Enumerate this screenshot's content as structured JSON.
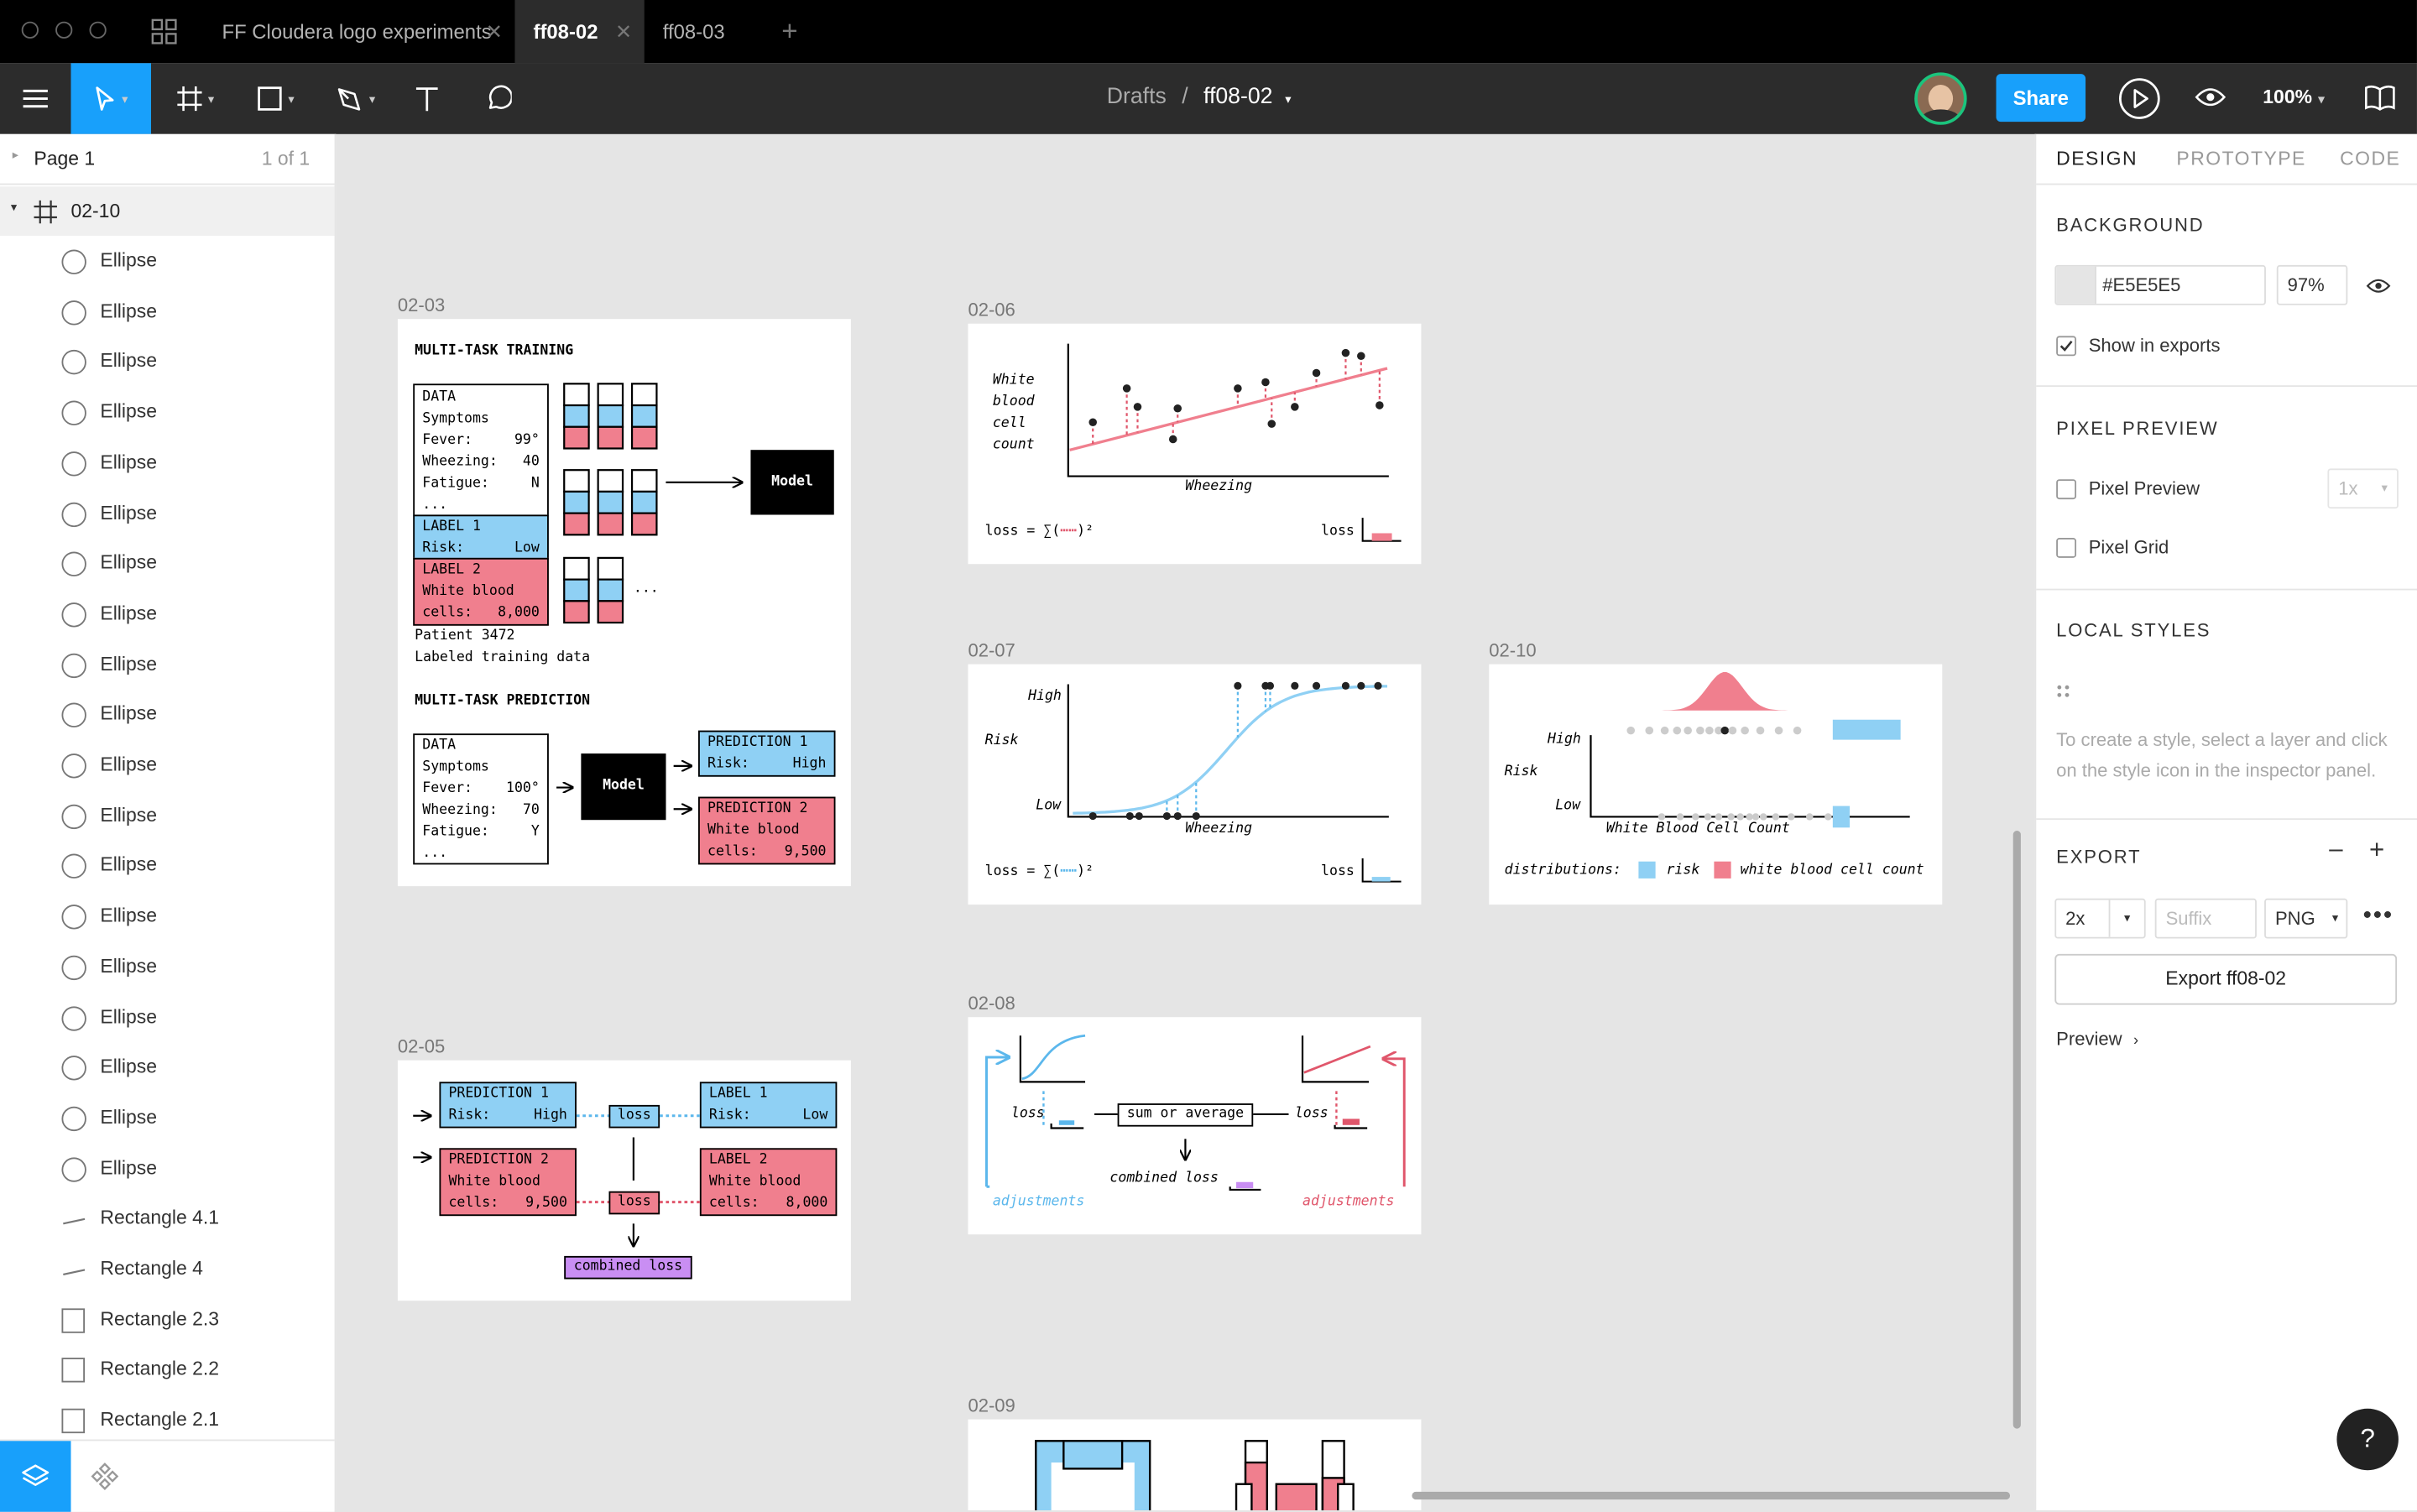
{
  "window": {
    "tabs": [
      {
        "label": "FF Cloudera logo experiments",
        "active": false
      },
      {
        "label": "ff08-02",
        "active": true
      },
      {
        "label": "ff08-03",
        "active": false
      }
    ]
  },
  "toolbar": {
    "breadcrumb_root": "Drafts",
    "breadcrumb_sep": "/",
    "file_name": "ff08-02",
    "share_label": "Share",
    "zoom": "100%"
  },
  "layers": {
    "page_name": "Page 1",
    "page_count": "1 of 1",
    "frame_name": "02-10",
    "items": [
      {
        "name": "Ellipse",
        "kind": "ellipse"
      },
      {
        "name": "Ellipse",
        "kind": "ellipse"
      },
      {
        "name": "Ellipse",
        "kind": "ellipse"
      },
      {
        "name": "Ellipse",
        "kind": "ellipse"
      },
      {
        "name": "Ellipse",
        "kind": "ellipse"
      },
      {
        "name": "Ellipse",
        "kind": "ellipse"
      },
      {
        "name": "Ellipse",
        "kind": "ellipse"
      },
      {
        "name": "Ellipse",
        "kind": "ellipse"
      },
      {
        "name": "Ellipse",
        "kind": "ellipse"
      },
      {
        "name": "Ellipse",
        "kind": "ellipse"
      },
      {
        "name": "Ellipse",
        "kind": "ellipse"
      },
      {
        "name": "Ellipse",
        "kind": "ellipse"
      },
      {
        "name": "Ellipse",
        "kind": "ellipse"
      },
      {
        "name": "Ellipse",
        "kind": "ellipse"
      },
      {
        "name": "Ellipse",
        "kind": "ellipse"
      },
      {
        "name": "Ellipse",
        "kind": "ellipse"
      },
      {
        "name": "Ellipse",
        "kind": "ellipse"
      },
      {
        "name": "Ellipse",
        "kind": "ellipse"
      },
      {
        "name": "Ellipse",
        "kind": "ellipse"
      },
      {
        "name": "Rectangle 4.1",
        "kind": "vector"
      },
      {
        "name": "Rectangle 4",
        "kind": "vector"
      },
      {
        "name": "Rectangle 2.3",
        "kind": "rect"
      },
      {
        "name": "Rectangle 2.2",
        "kind": "rect"
      },
      {
        "name": "Rectangle 2.1",
        "kind": "rect"
      }
    ]
  },
  "inspector": {
    "tabs": [
      "DESIGN",
      "PROTOTYPE",
      "CODE"
    ],
    "background_title": "BACKGROUND",
    "bg_color": "#E5E5E5",
    "bg_opacity": "97%",
    "show_in_exports": "Show in exports",
    "pixel_preview_title": "PIXEL PREVIEW",
    "pixel_preview": "Pixel Preview",
    "pixel_preview_scale": "1x",
    "pixel_grid": "Pixel Grid",
    "local_styles_title": "LOCAL STYLES",
    "local_styles_hint": "To create a style, select a layer and click on the style icon in the inspector panel.",
    "export_title": "EXPORT",
    "export_scale": "2x",
    "export_suffix_placeholder": "Suffix",
    "export_format": "PNG",
    "export_button": "Export ff08-02",
    "preview_label": "Preview"
  },
  "canvas": {
    "f0203": {
      "label": "02-03",
      "train_title": "MULTI-TASK TRAINING",
      "data_lines": [
        "DATA",
        "Symptoms"
      ],
      "data_rows": [
        [
          "Fever:",
          "99°"
        ],
        [
          "Wheezing:",
          "40"
        ],
        [
          "Fatigue:",
          "N"
        ]
      ],
      "ellipsis": "...",
      "label1": "LABEL 1",
      "label1_row": [
        "Risk:",
        "Low"
      ],
      "label2": "LABEL 2",
      "label2_line": "White blood",
      "label2_row": [
        "cells:",
        "8,000"
      ],
      "patient": "Patient 3472",
      "labeled": "Labeled training data",
      "model": "Model",
      "pred_title": "MULTI-TASK PREDICTION",
      "pdata_rows": [
        [
          "Fever:",
          "100°"
        ],
        [
          "Wheezing:",
          "70"
        ],
        [
          "Fatigue:",
          "Y"
        ]
      ],
      "p1": "PREDICTION 1",
      "p1_row": [
        "Risk:",
        "High"
      ],
      "p2": "PREDICTION 2",
      "p2_line": "White blood",
      "p2_row": [
        "cells:",
        "9,500"
      ]
    },
    "f0205": {
      "label": "02-05",
      "loss": "loss",
      "combined": "combined loss"
    },
    "f0206": {
      "label": "02-06",
      "ylabel": [
        "White",
        "blood",
        "cell",
        "count"
      ],
      "xlabel": "Wheezing",
      "formula": "loss = ∑(",
      "formula_end": ")²",
      "loss": "loss"
    },
    "f0207": {
      "label": "02-07",
      "high": "High",
      "risk": "Risk",
      "low": "Low",
      "xlabel": "Wheezing",
      "formula": "loss = ∑(",
      "formula_end": ")²",
      "loss": "loss"
    },
    "f0208": {
      "label": "02-08",
      "loss": "loss",
      "sum": "sum or average",
      "combined": "combined loss",
      "adjustments": "adjustments"
    },
    "f0209": {
      "label": "02-09"
    },
    "f0210": {
      "label": "02-10",
      "high": "High",
      "risk": "Risk",
      "low": "Low",
      "xlabel": "White Blood Cell Count",
      "dist": "distributions:",
      "risk_legend": "risk",
      "wbc_legend": "white blood cell count"
    }
  },
  "colors": {
    "blue": "#8fd0f4",
    "pink": "#f07f8e",
    "purple": "#c98ef3",
    "share": "#18a0fb"
  }
}
